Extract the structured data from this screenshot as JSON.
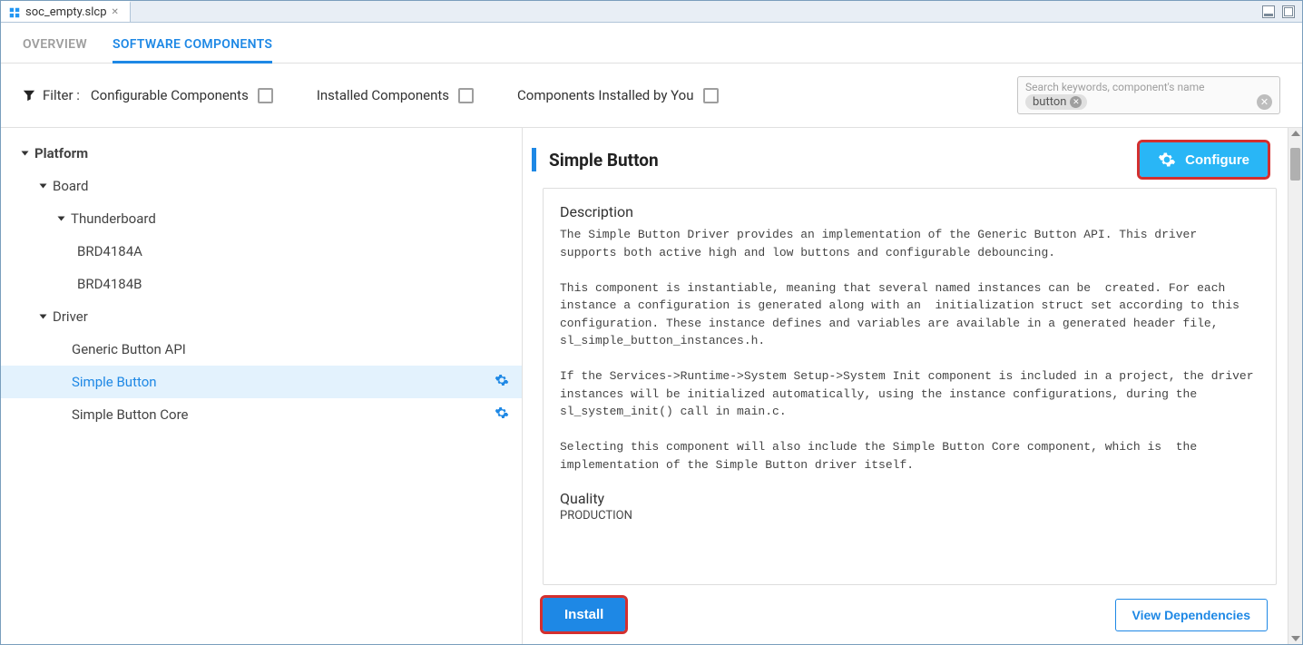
{
  "file_tab": {
    "label": "soc_empty.slcp"
  },
  "tabs": {
    "overview": "OVERVIEW",
    "software_components": "SOFTWARE COMPONENTS"
  },
  "filter": {
    "label": "Filter :",
    "configurable": "Configurable Components",
    "installed": "Installed Components",
    "by_you": "Components Installed by You"
  },
  "search": {
    "placeholder": "Search keywords, component's name",
    "chip": "button"
  },
  "tree": {
    "platform": "Platform",
    "board": "Board",
    "thunderboard": "Thunderboard",
    "brd_a": "BRD4184A",
    "brd_b": "BRD4184B",
    "driver": "Driver",
    "generic_button": "Generic Button API",
    "simple_button": "Simple Button",
    "simple_button_core": "Simple Button Core"
  },
  "detail": {
    "title": "Simple Button",
    "configure": "Configure",
    "desc_heading": "Description",
    "desc_body": "The Simple Button Driver provides an implementation of the Generic Button API. This driver supports both active high and low buttons and configurable debouncing.\n\nThis component is instantiable, meaning that several named instances can be  created. For each instance a configuration is generated along with an  initialization struct set according to this configuration. These instance defines and variables are available in a generated header file,  sl_simple_button_instances.h.\n\nIf the Services->Runtime->System Setup->System Init component is included in a project, the driver instances will be initialized automatically, using the instance configurations, during the sl_system_init() call in main.c.\n\nSelecting this component will also include the Simple Button Core component, which is  the implementation of the Simple Button driver itself.",
    "quality_heading": "Quality",
    "quality_value": "PRODUCTION",
    "install": "Install",
    "view_deps": "View Dependencies"
  }
}
